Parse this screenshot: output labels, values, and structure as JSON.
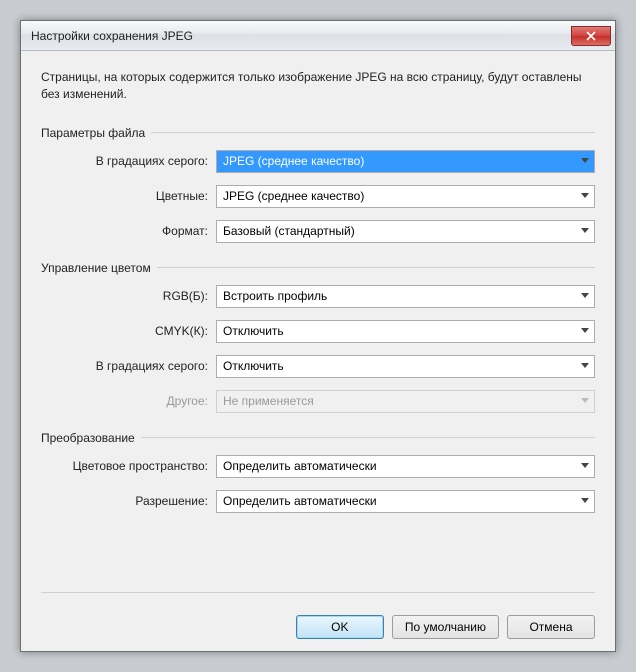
{
  "title": "Настройки сохранения JPEG",
  "info": "Страницы, на которых содержится только изображение JPEG на всю страницу, будут оставлены без изменений.",
  "groups": {
    "file": {
      "title": "Параметры файла",
      "grayscale": {
        "label": "В градациях серого:",
        "value": "JPEG (среднее качество)"
      },
      "color": {
        "label": "Цветные:",
        "value": "JPEG (среднее качество)"
      },
      "format": {
        "label": "Формат:",
        "value": "Базовый (стандартный)"
      }
    },
    "colormgmt": {
      "title": "Управление цветом",
      "rgb": {
        "label": "RGB(Б):",
        "value": "Встроить профиль"
      },
      "cmyk": {
        "label": "CMYK(К):",
        "value": "Отключить"
      },
      "gray": {
        "label": "В градациях серого:",
        "value": "Отключить"
      },
      "other": {
        "label": "Другое:",
        "value": "Не применяется"
      }
    },
    "transform": {
      "title": "Преобразование",
      "colorspace": {
        "label": "Цветовое пространство:",
        "value": "Определить автоматически"
      },
      "resolution": {
        "label": "Разрешение:",
        "value": "Определить автоматически"
      }
    }
  },
  "buttons": {
    "ok": "OK",
    "defaults": "По умолчанию",
    "cancel": "Отмена"
  }
}
